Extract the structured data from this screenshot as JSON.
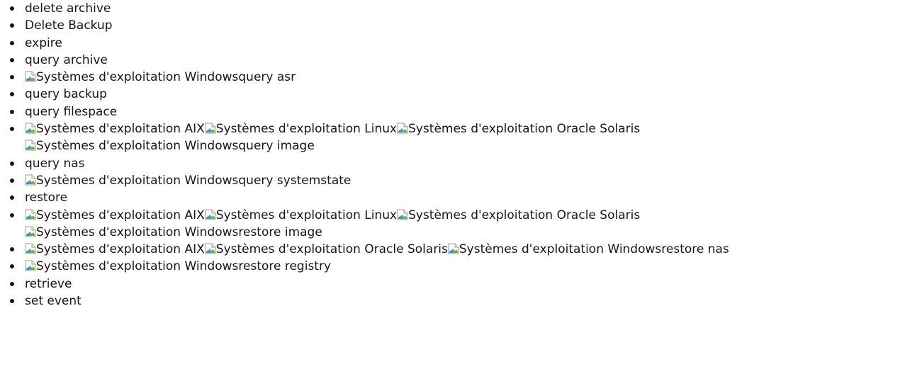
{
  "items": [
    {
      "segments": [
        {
          "type": "text",
          "text": "delete archive"
        }
      ]
    },
    {
      "segments": [
        {
          "type": "text",
          "text": "Delete Backup"
        }
      ]
    },
    {
      "segments": [
        {
          "type": "text",
          "text": "expire"
        }
      ]
    },
    {
      "segments": [
        {
          "type": "text",
          "text": "query archive"
        }
      ]
    },
    {
      "segments": [
        {
          "type": "image",
          "alt": "Systèmes d'exploitation Windows",
          "icon": "broken-image-icon"
        },
        {
          "type": "text",
          "text": "query asr"
        }
      ]
    },
    {
      "segments": [
        {
          "type": "text",
          "text": "query backup"
        }
      ]
    },
    {
      "segments": [
        {
          "type": "text",
          "text": "query filespace"
        }
      ]
    },
    {
      "segments": [
        {
          "type": "image",
          "alt": "Systèmes d'exploitation AIX",
          "icon": "broken-image-icon"
        },
        {
          "type": "image",
          "alt": "Systèmes d'exploitation Linux",
          "icon": "broken-image-icon"
        },
        {
          "type": "image",
          "alt": "Systèmes d'exploitation Oracle Solaris",
          "icon": "broken-image-icon"
        },
        {
          "type": "break"
        },
        {
          "type": "image",
          "alt": "Systèmes d'exploitation Windows",
          "icon": "broken-image-icon"
        },
        {
          "type": "text",
          "text": "query image"
        }
      ]
    },
    {
      "segments": [
        {
          "type": "text",
          "text": "query nas"
        }
      ]
    },
    {
      "segments": [
        {
          "type": "image",
          "alt": "Systèmes d'exploitation Windows",
          "icon": "broken-image-icon"
        },
        {
          "type": "text",
          "text": "query systemstate"
        }
      ]
    },
    {
      "segments": [
        {
          "type": "text",
          "text": "restore"
        }
      ]
    },
    {
      "segments": [
        {
          "type": "image",
          "alt": "Systèmes d'exploitation AIX",
          "icon": "broken-image-icon"
        },
        {
          "type": "image",
          "alt": "Systèmes d'exploitation Linux",
          "icon": "broken-image-icon"
        },
        {
          "type": "image",
          "alt": "Systèmes d'exploitation Oracle Solaris",
          "icon": "broken-image-icon"
        },
        {
          "type": "break"
        },
        {
          "type": "image",
          "alt": "Systèmes d'exploitation Windows",
          "icon": "broken-image-icon"
        },
        {
          "type": "text",
          "text": "restore image"
        }
      ]
    },
    {
      "segments": [
        {
          "type": "image",
          "alt": "Systèmes d'exploitation AIX",
          "icon": "broken-image-icon"
        },
        {
          "type": "image",
          "alt": "Systèmes d'exploitation Oracle Solaris",
          "icon": "broken-image-icon"
        },
        {
          "type": "image",
          "alt": "Systèmes d'exploitation Windows",
          "icon": "broken-image-icon"
        },
        {
          "type": "text",
          "text": "restore nas"
        }
      ]
    },
    {
      "segments": [
        {
          "type": "image",
          "alt": "Systèmes d'exploitation Windows",
          "icon": "broken-image-icon"
        },
        {
          "type": "text",
          "text": "restore registry"
        }
      ]
    },
    {
      "segments": [
        {
          "type": "text",
          "text": "retrieve"
        }
      ]
    },
    {
      "segments": [
        {
          "type": "text",
          "text": "set event"
        }
      ]
    }
  ]
}
